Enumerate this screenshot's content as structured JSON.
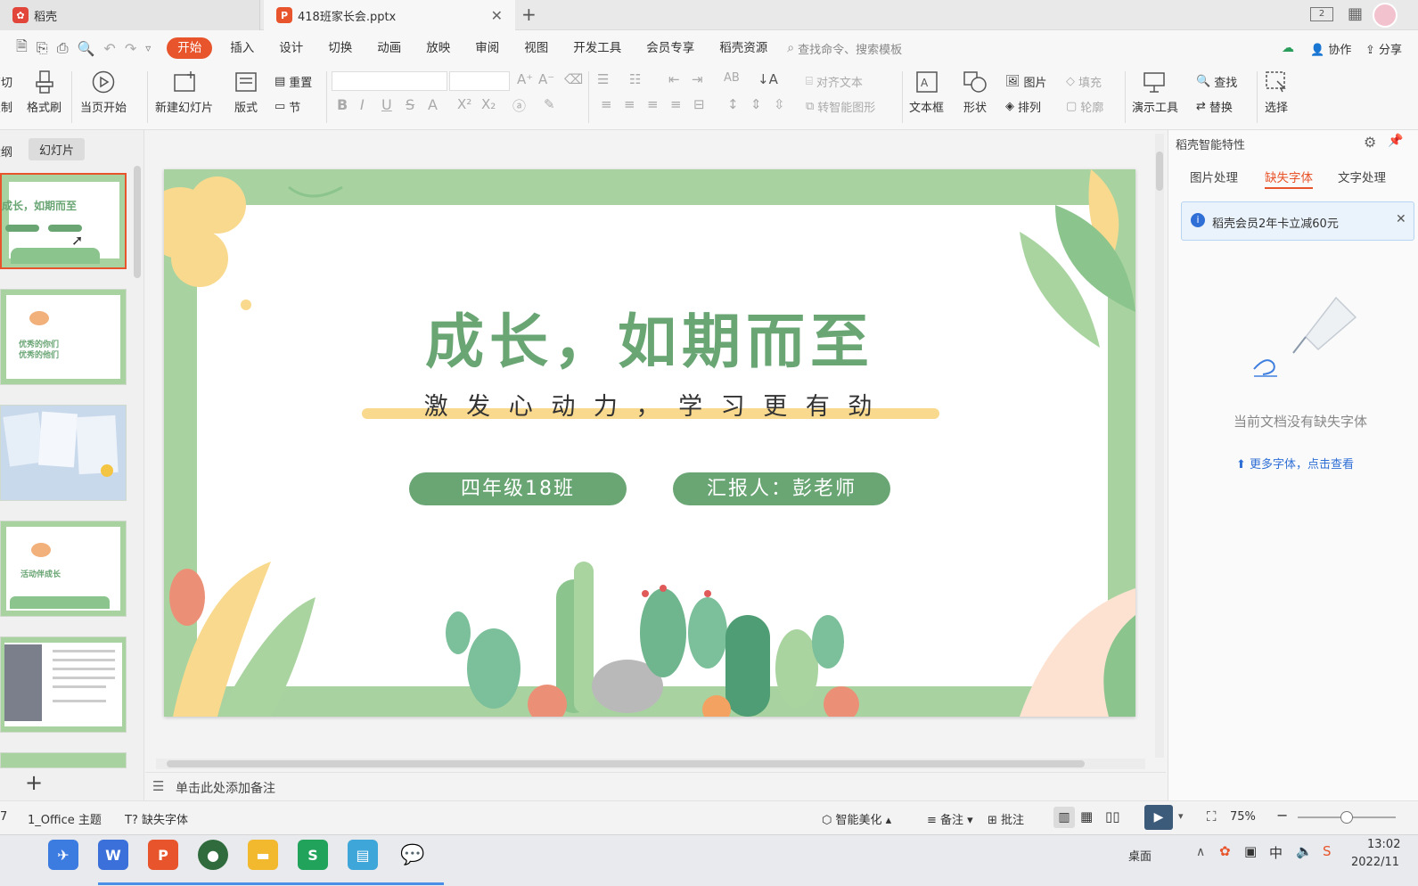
{
  "tabs": [
    {
      "label": "稻壳"
    },
    {
      "label": "418班家长会.pptx"
    }
  ],
  "menu": {
    "items": [
      "开始",
      "插入",
      "设计",
      "切换",
      "动画",
      "放映",
      "审阅",
      "视图",
      "开发工具",
      "会员专享",
      "稻壳资源"
    ],
    "search_placeholder": "查找命令、搜索模板",
    "collab": "协作",
    "share": "分享"
  },
  "ribbon": {
    "cut": "剪切",
    "copy": "复制",
    "format_painter": "格式刷",
    "play_from_current": "当页开始",
    "new_slide": "新建幻灯片",
    "layout": "版式",
    "reset": "重置",
    "section": "节",
    "align_text": "对齐文本",
    "smart_graphic": "转智能图形",
    "textbox": "文本框",
    "shape": "形状",
    "picture": "图片",
    "arrange": "排列",
    "fill": "填充",
    "outline": "轮廓",
    "present_tools": "演示工具",
    "find": "查找",
    "replace": "替换",
    "select": "选择"
  },
  "left_panel": {
    "outline_tab": "大纲",
    "slides_tab": "幻灯片",
    "thumb1_title": "成长，如期而至",
    "thumb2_line1": "优秀的你们",
    "thumb2_line2": "优秀的他们",
    "thumb4_title": "活动伴成长"
  },
  "slide": {
    "title": "成长，如期而至",
    "subtitle": "激 发 心 动 力 ， 学 习 更 有 劲",
    "pill_left": "四年级18班",
    "pill_right": "汇报人：彭老师"
  },
  "notes_placeholder": "单击此处添加备注",
  "right_panel": {
    "header": "稻壳智能特性",
    "tabs": [
      "图片处理",
      "缺失字体",
      "文字处理"
    ],
    "active_tab": 1,
    "promo": "稻壳会员2年卡立减60元",
    "empty_msg": "当前文档没有缺失字体",
    "more_link": "更多字体，点击查看"
  },
  "status": {
    "slide_count": "7",
    "theme": "1_Office 主题",
    "missing_font": "缺失字体",
    "smart_beautify": "智能美化",
    "notes": "备注",
    "comments": "批注",
    "zoom": "75%"
  },
  "taskbar": {
    "desktop": "桌面",
    "time": "13:02",
    "date": "2022/11"
  },
  "colors": {
    "accent": "#e8542b",
    "slide_green": "#6aa574",
    "frame_green": "#a8d3a0",
    "underline_yellow": "#f9d98e"
  }
}
